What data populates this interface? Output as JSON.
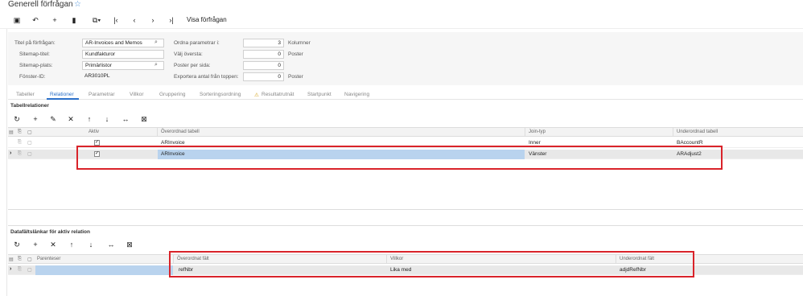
{
  "header": {
    "title": "Generell förfrågan",
    "star": "☆"
  },
  "toolbar": {
    "save": "💾",
    "undo": "↶",
    "add": "+",
    "delete": "🗑",
    "copy_paste": "⧉▾",
    "first": "|‹",
    "prev": "‹",
    "next": "›",
    "last": "›|",
    "view_inquiry": "Visa förfrågan"
  },
  "form": {
    "inquiry_title_label": "Titel på förfrågan:",
    "inquiry_title_value": "AR-Invoices and Memos",
    "sitemap_title_label": "Sitemap-titel:",
    "sitemap_title_value": "Kundfakturor",
    "sitemap_location_label": "Sitemap-plats:",
    "sitemap_location_value": "Primärlistor",
    "screen_id_label": "Fönster-ID:",
    "screen_id_value": "AR3010PL",
    "arrange_params_label": "Ordna parametrar i:",
    "arrange_params_value": "3",
    "arrange_params_unit": "Kolumner",
    "select_top_label": "Välj översta:",
    "select_top_value": "0",
    "select_top_unit": "Poster",
    "records_per_page_label": "Poster per sida:",
    "records_per_page_value": "0",
    "export_top_label": "Exportera antal från toppen:",
    "export_top_value": "0",
    "export_top_unit": "Poster"
  },
  "tabs": [
    "Tabeller",
    "Relationer",
    "Parametrar",
    "Villkor",
    "Gruppering",
    "Sorteringsordning",
    "Resultatrutnät",
    "Startpunkt",
    "Navigering"
  ],
  "relations": {
    "section_title": "Tabellrelationer",
    "toolbar": {
      "refresh": "↻",
      "add": "+",
      "edit": "✎",
      "delete": "✕",
      "up": "↑",
      "down": "↓",
      "fit": "↔",
      "export": "⊠"
    },
    "columns": {
      "active": "Aktiv",
      "parent_table": "Överordnad tabell",
      "join_type": "Join-typ",
      "child_table": "Underordnad tabell"
    },
    "rows": [
      {
        "active": true,
        "parent_table": "ARInvoice",
        "join_type": "Inner",
        "child_table": "BAccountR"
      },
      {
        "active": true,
        "parent_table": "ARInvoice",
        "join_type": "Vänster",
        "child_table": "ARAdjust2"
      }
    ]
  },
  "links": {
    "section_title": "Datafältslänkar för aktiv relation",
    "toolbar": {
      "refresh": "↻",
      "add": "+",
      "delete": "✕",
      "up": "↑",
      "down": "↓",
      "fit": "↔",
      "export": "⊠"
    },
    "columns": {
      "parentheses": "Parenteser",
      "parent_field": "Överordnat fält",
      "condition": "Villkor",
      "child_field": "Underordnat fält"
    },
    "rows": [
      {
        "parent_field": "refNbr",
        "condition": "Lika med",
        "child_field": "adjdRefNbr"
      }
    ]
  },
  "icons": {
    "row_arrow": "›",
    "checkmark": "✓",
    "warning": "⚠",
    "attach": "⎘",
    "note": "▢"
  },
  "colors": {
    "accent": "#2b70c9",
    "highlight_box": "#d9232a",
    "selected_cell": "#b9d3ee"
  }
}
